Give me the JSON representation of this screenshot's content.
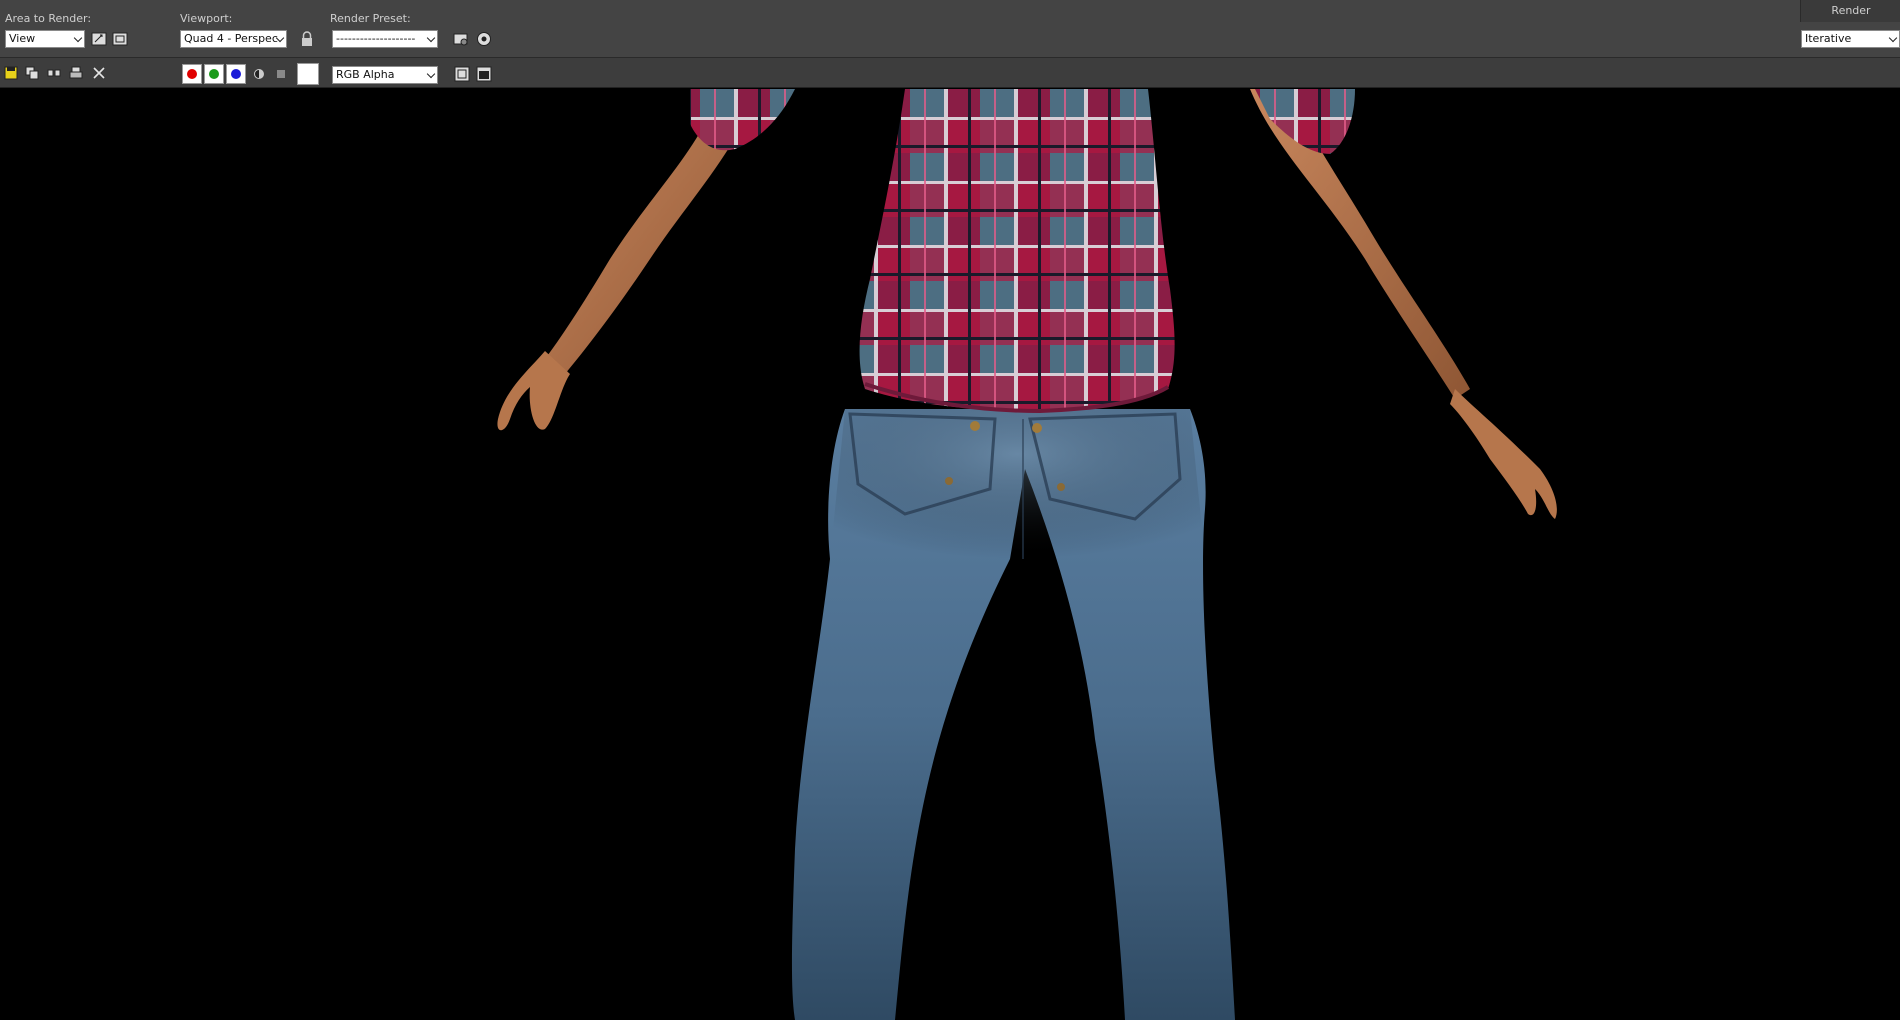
{
  "toolbar": {
    "area_label": "Area to Render:",
    "area_value": "View",
    "viewport_label": "Viewport:",
    "viewport_value": "Quad 4 - Perspec",
    "preset_label": "Render Preset:",
    "preset_value": "--------------------",
    "render_label": "Render",
    "render_mode": "Iterative",
    "channel_value": "RGB Alpha"
  },
  "colors": {
    "toolbar_bg": "#444444",
    "red_channel": "#e00000",
    "green_channel": "#1a9a1a",
    "blue_channel": "#1a1ad8",
    "plaid_red": "#b3163f",
    "plaid_blue": "#3f6f88",
    "denim": "#4e6f8e"
  }
}
